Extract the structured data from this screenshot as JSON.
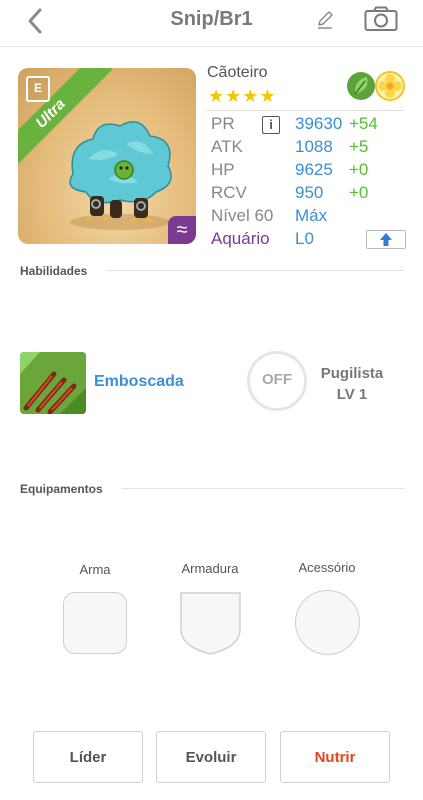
{
  "header": {
    "title": "Snip/Br1",
    "back_icon": "chevron-left-icon",
    "edit_icon": "pencil-icon",
    "camera_icon": "camera-icon"
  },
  "monster": {
    "ribbon_label": "Ultra",
    "rank_badge": "E",
    "element_symbol": "≈",
    "name": "Cãoteiro",
    "stars": "★★★★",
    "stars_count": 4,
    "type_icons": [
      "leaf-icon",
      "flower-icon"
    ]
  },
  "stats": {
    "pr": {
      "label": "PR",
      "value": "39630",
      "bonus": "+54"
    },
    "atk": {
      "label": "ATK",
      "value": "1088",
      "bonus": "+5"
    },
    "hp": {
      "label": "HP",
      "value": "9625",
      "bonus": "+0"
    },
    "rcv": {
      "label": "RCV",
      "value": "950",
      "bonus": "+0"
    },
    "level": {
      "label": "Nível 60",
      "value": "Máx"
    },
    "element": {
      "label": "Aquário",
      "value": "L0"
    },
    "info_label": "i"
  },
  "skills": {
    "section_title": "Habilidades",
    "active": {
      "name": "Emboscada"
    },
    "passive": {
      "state": "OFF",
      "name": "Pugilista",
      "level": "LV 1"
    }
  },
  "equipment": {
    "section_title": "Equipamentos",
    "weapon_label": "Arma",
    "armor_label": "Armadura",
    "accessory_label": "Acessório"
  },
  "actions": {
    "leader": "Líder",
    "evolve": "Evoluir",
    "feed": "Nutrir"
  },
  "colors": {
    "accent_blue": "#3a8fd6",
    "bonus_green": "#55c02a",
    "element_purple": "#7b3a92",
    "feed_red": "#e8421e",
    "star_yellow": "#f5c400"
  }
}
